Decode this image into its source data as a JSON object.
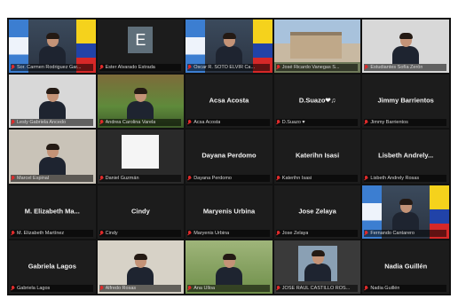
{
  "tiles": [
    {
      "kind": "video",
      "video": "flags",
      "label": "Sor. Carmen Rodriguez Gar...",
      "active": false
    },
    {
      "kind": "avatar",
      "initial": "E",
      "label": "Ester Alvarado Estrada",
      "active": false
    },
    {
      "kind": "video",
      "video": "flags",
      "label": "Oscar R. SOTO ELVIR Ca...",
      "active": false
    },
    {
      "kind": "video",
      "video": "building",
      "label": "José Ricardo Vanegas S...",
      "active": false
    },
    {
      "kind": "video",
      "video": "room",
      "label": "Estudiantes Sofía Zerón",
      "active": false
    },
    {
      "kind": "video",
      "video": "room",
      "label": "Lesly Gabriela Ancedo",
      "active": false
    },
    {
      "kind": "video",
      "video": "green",
      "label": "Andrea Carolina Varela",
      "active": true
    },
    {
      "kind": "name",
      "name": "Acsa Acosta",
      "label": "Acsa Acosta",
      "active": false
    },
    {
      "kind": "name",
      "name": "D.Suazo❤︎♫",
      "label": "D.Suazo ♥",
      "active": false
    },
    {
      "kind": "name",
      "name": "Jimmy Barrientos",
      "label": "Jimmy Barrientos",
      "active": false
    },
    {
      "kind": "video",
      "video": "office",
      "label": "Marcel Espinal",
      "active": false
    },
    {
      "kind": "video",
      "video": "white",
      "label": "Daniel Guzmán",
      "active": false
    },
    {
      "kind": "name",
      "name": "Dayana Perdomo",
      "label": "Dayana Perdomo",
      "active": false
    },
    {
      "kind": "name",
      "name": "Katerihn Isasi",
      "label": "Katerihn Isasi",
      "active": false
    },
    {
      "kind": "name",
      "name": "Lisbeth Andrely...",
      "label": "Lisbeth Andrely Rosas",
      "active": false
    },
    {
      "kind": "name",
      "name": "M. Elizabeth Ma...",
      "label": "M. Elizabeth Martínez",
      "active": false
    },
    {
      "kind": "name",
      "name": "Cindy",
      "label": "Cindy",
      "active": false
    },
    {
      "kind": "name",
      "name": "Maryenis Urbina",
      "label": "Maryenis Urbina",
      "active": false
    },
    {
      "kind": "name",
      "name": "Jose Zelaya",
      "label": "Jose Zelaya",
      "active": false
    },
    {
      "kind": "video",
      "video": "flags",
      "label": "Fernando Cantarero",
      "active": false
    },
    {
      "kind": "name",
      "name": "Gabriela Lagos",
      "label": "Gabriela Lagos",
      "active": false
    },
    {
      "kind": "video",
      "video": "wall",
      "label": "Alfredo Rosas",
      "active": false
    },
    {
      "kind": "video",
      "video": "outdoor",
      "label": "Ana Ulloa",
      "active": false
    },
    {
      "kind": "video",
      "video": "small",
      "label": "JOSE RAUL CASTILLO ROS...",
      "active": false
    },
    {
      "kind": "name",
      "name": "Nadia Guillén",
      "label": "Nadia Guillén",
      "active": false
    }
  ]
}
